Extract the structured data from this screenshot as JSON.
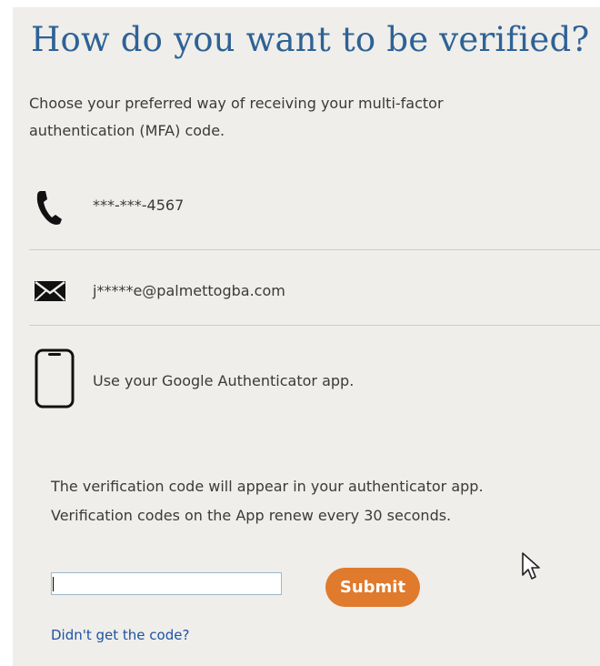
{
  "page": {
    "title": "How do you want to be verified?",
    "intro": "Choose your preferred way of receiving your multi-factor authentication (MFA) code."
  },
  "options": [
    {
      "label": "***-***-4567",
      "icon": "phone-icon"
    },
    {
      "label": "j*****e@palmettogba.com",
      "icon": "envelope-icon"
    },
    {
      "label": "Use your Google Authenticator app.",
      "icon": "smartphone-icon"
    }
  ],
  "authenticator": {
    "note_line1": "The verification code will appear in your authenticator app.",
    "note_line2": "Verification codes on the App renew every 30 seconds.",
    "input_value": "",
    "input_placeholder": "",
    "submit_label": "Submit",
    "help_link": "Didn't get the code?"
  },
  "colors": {
    "title": "#2e6296",
    "submit": "#e07a2c",
    "link": "#1d52a3",
    "panel_background": "#efeeea"
  }
}
